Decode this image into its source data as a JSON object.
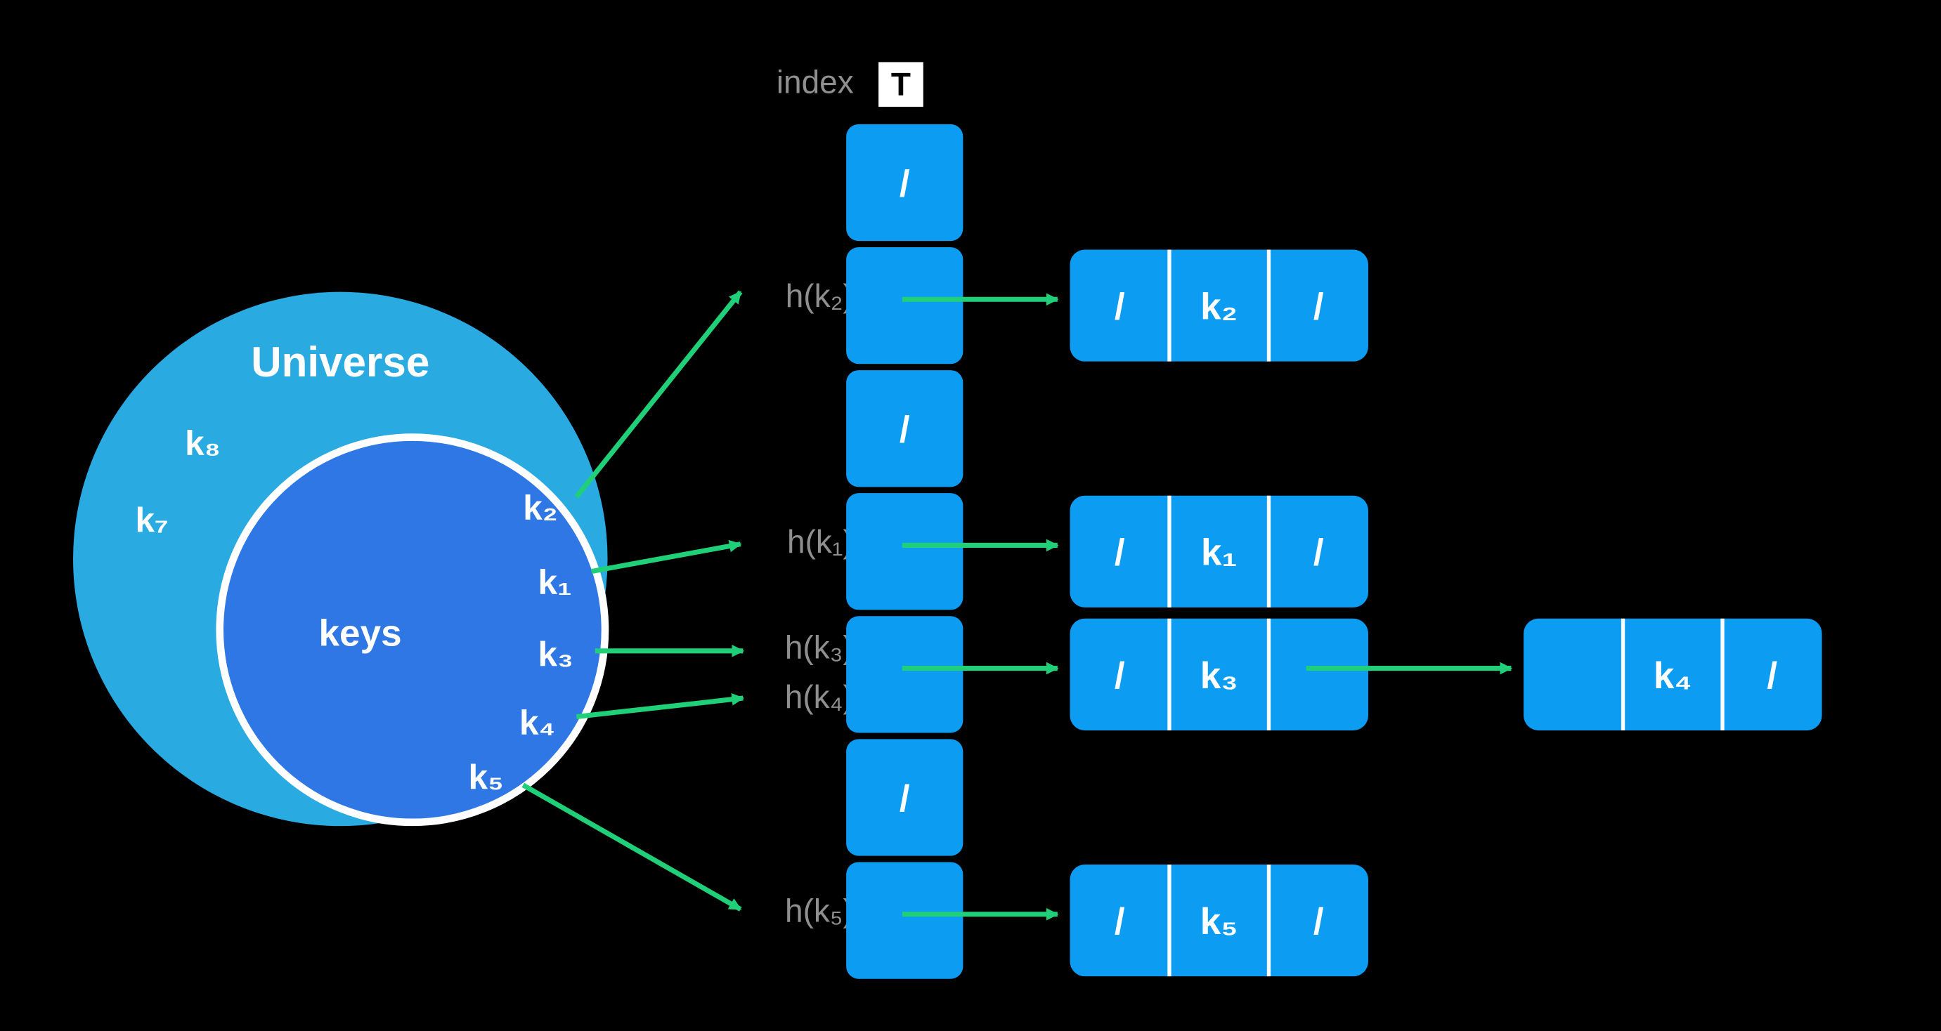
{
  "colors": {
    "bg": "#000000",
    "outerCircle": "#29abe2",
    "innerCircle": "#2e77e5",
    "slot": "#0c9cf2",
    "arrow": "#20d079",
    "muted": "#8f8f8f",
    "white": "#ffffff"
  },
  "header": {
    "indexLabel": "index",
    "tableLabel": "T"
  },
  "universe": {
    "title": "Universe",
    "keysTitle": "keys",
    "outerKeys": [
      "k₈",
      "k₇"
    ],
    "innerKeys": [
      "k₂",
      "k₁",
      "k₃",
      "k₄",
      "k₅"
    ]
  },
  "hashLabels": {
    "r1": "h(k₂)",
    "r3": "h(k₁)",
    "r4a": "h(k₃)",
    "r4b": "h(k₄)",
    "r6": "h(k₅)"
  },
  "table": {
    "slots": [
      {
        "label": "/"
      },
      {
        "label": ""
      },
      {
        "label": "/"
      },
      {
        "label": ""
      },
      {
        "label": ""
      },
      {
        "label": "/"
      },
      {
        "label": ""
      }
    ]
  },
  "nodes": {
    "n1": {
      "prev": "/",
      "key": "k₂",
      "next": "/"
    },
    "n3": {
      "prev": "/",
      "key": "k₁",
      "next": "/"
    },
    "n4a": {
      "prev": "/",
      "key": "k₃",
      "next": ""
    },
    "n4b": {
      "prev": "",
      "key": "k₄",
      "next": "/"
    },
    "n6": {
      "prev": "/",
      "key": "k₅",
      "next": "/"
    }
  }
}
